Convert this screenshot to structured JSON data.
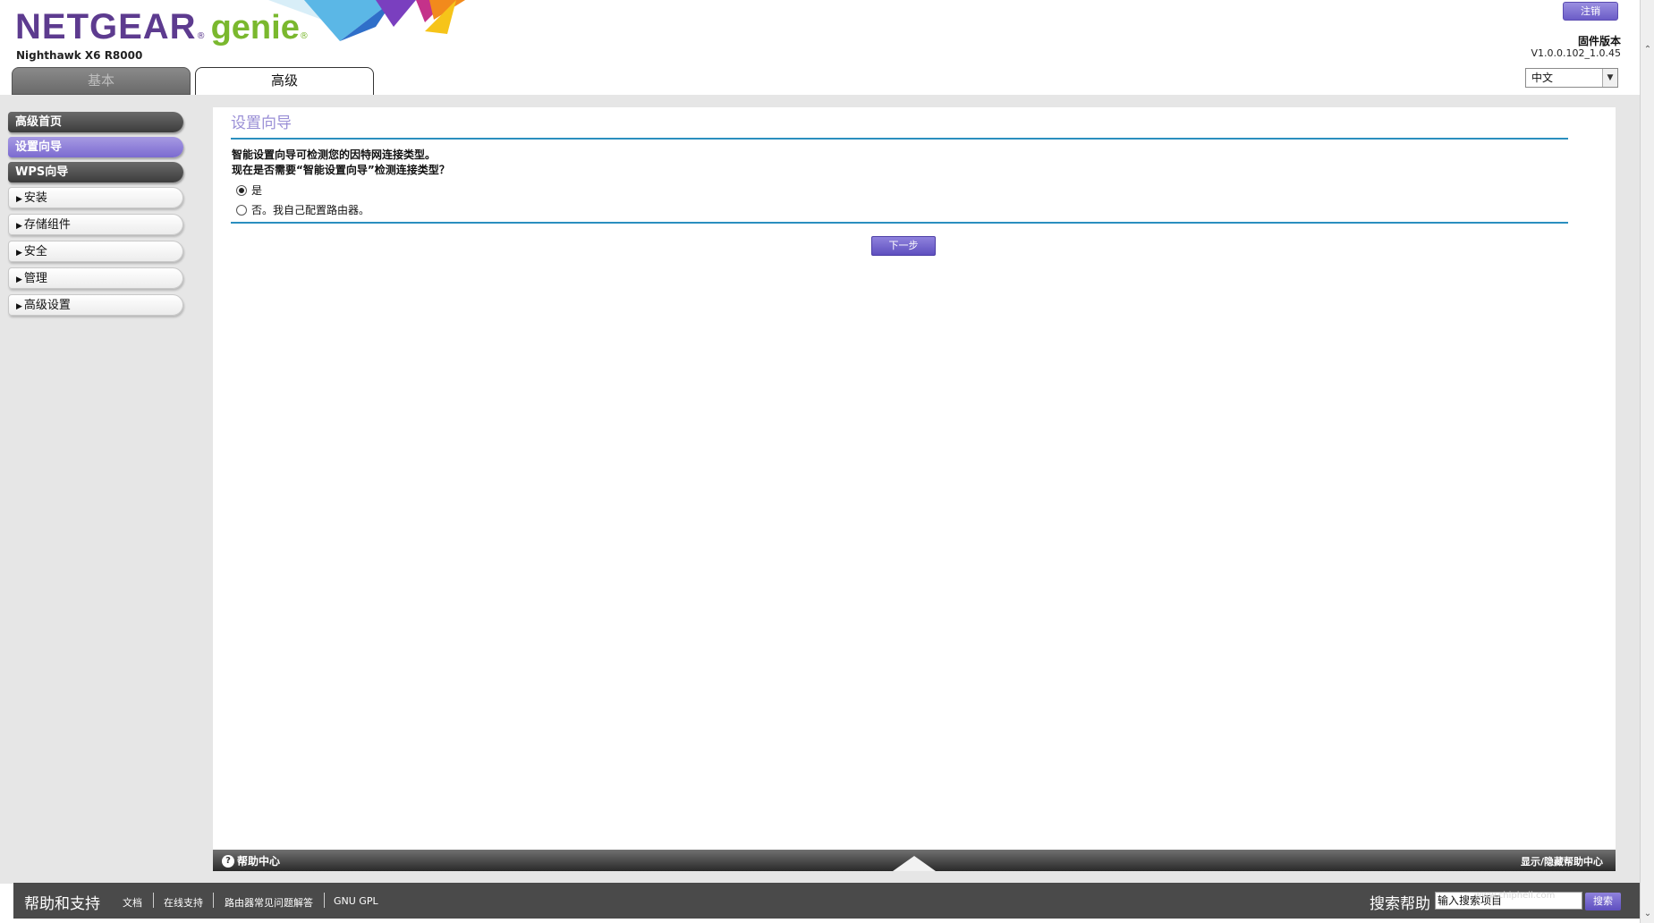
{
  "header": {
    "logo_netgear": "NETGEAR",
    "logo_reg": "®",
    "logo_genie": "genie",
    "logo_reg2": "®",
    "model": "Nighthawk X6 R8000",
    "logout_label": "注销",
    "firmware_label": "固件版本",
    "firmware_version": "V1.0.0.102_1.0.45",
    "language_selected": "中文",
    "tabs": [
      {
        "label": "基本",
        "active": false
      },
      {
        "label": "高级",
        "active": true
      }
    ]
  },
  "sidebar": {
    "items": [
      {
        "label": "高级首页",
        "style": "dark"
      },
      {
        "label": "设置向导",
        "style": "active"
      },
      {
        "label": "WPS向导",
        "style": "dark"
      },
      {
        "label": "安装",
        "style": "light"
      },
      {
        "label": "存储组件",
        "style": "light"
      },
      {
        "label": "安全",
        "style": "light"
      },
      {
        "label": "管理",
        "style": "light"
      },
      {
        "label": "高级设置",
        "style": "light"
      }
    ]
  },
  "main": {
    "title": "设置向导",
    "intro_line1": "智能设置向导可检测您的因特网连接类型。",
    "intro_line2": "现在是否需要“智能设置向导”检测连接类型？",
    "option_yes": "是",
    "option_no": "否。我自己配置路由器。",
    "selected_option": "yes",
    "next_label": "下一步"
  },
  "help_bar": {
    "label": "帮助中心",
    "toggle_label": "显示/隐藏帮助中心"
  },
  "footer": {
    "title": "帮助和支持",
    "links": [
      "文档",
      "在线支持",
      "路由器常见问题解答",
      "GNU GPL"
    ],
    "search_label": "搜索帮助",
    "search_placeholder": "输入搜索项目",
    "search_button": "搜索"
  },
  "watermark": "www.chiphell.com",
  "colors": {
    "brand_purple": "#5d3b8f",
    "brand_green": "#7ab82e",
    "accent_purple": "#7b6bd0",
    "rule_blue": "#2b8fbf"
  }
}
